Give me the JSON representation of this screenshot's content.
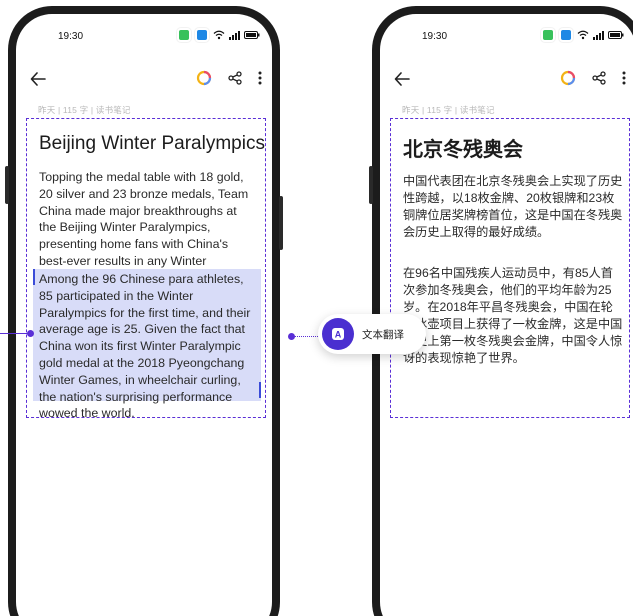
{
  "left_phone": {
    "status": {
      "time": "19:30"
    },
    "meta": "昨天 | 115 字 | 读书笔记",
    "note": {
      "title": "Beijing Winter Paralympics",
      "paragraph1": "Topping the medal table with 18 gold, 20 silver and 23 bronze medals, Team China made major breakthroughs at the Beijing Winter Paralympics, presenting home fans with China's best-ever results in any Winter Paralympics.",
      "paragraph2_selected": "Among the 96 Chinese para athletes, 85 participated in the Winter Paralympics for the first time, and their average age is 25. Given the fact that China won its first Winter Paralympic gold medal at the 2018 Pyeongchang Winter Games, in wheelchair curling, the nation's surprising performance wowed the world."
    }
  },
  "right_phone": {
    "status": {
      "time": "19:30"
    },
    "meta": "昨天 | 115 字 | 读书笔记",
    "note": {
      "title": "北京冬残奥会",
      "paragraph1": "中国代表团在北京冬残奥会上实现了历史性跨越，以18枚金牌、20枚银牌和23枚铜牌位居奖牌榜首位，这是中国在冬残奥会历史上取得的最好成绩。",
      "paragraph2": "在96名中国残疾人运动员中，有85人首次参加冬残奥会，他们的平均年龄为25岁。在2018年平昌冬残奥会，中国在轮椅冰壶项目上获得了一枚金牌，这是中国历史上第一枚冬残奥会金牌，中国令人惊讶的表现惊艳了世界。"
    }
  },
  "translate_action": {
    "label": "文本翻译",
    "icon_letter": "A"
  },
  "colors": {
    "accent": "#5a2fd6",
    "selection": "#d8dcf8",
    "app_green": "#38c15b",
    "app_blue": "#1e88e5"
  }
}
